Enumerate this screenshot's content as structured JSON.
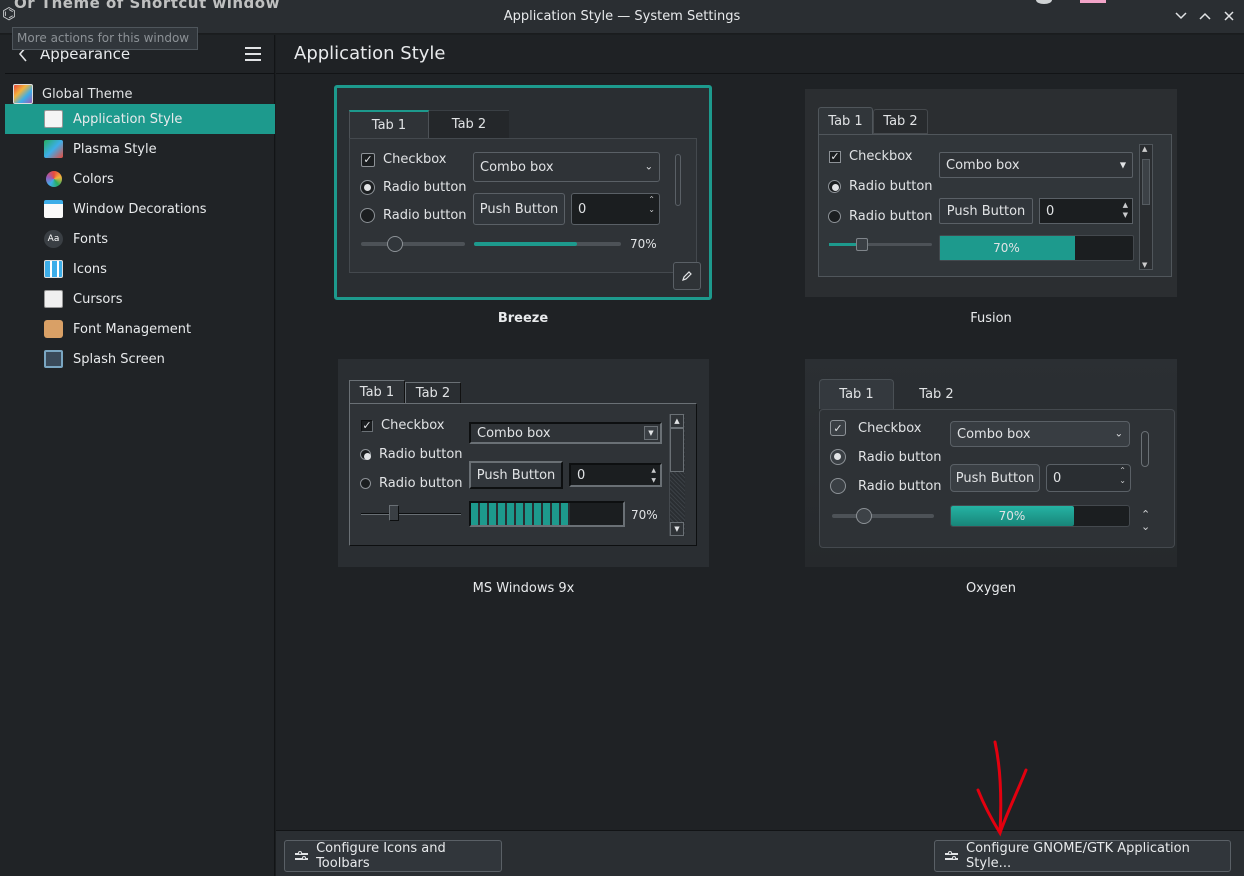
{
  "window": {
    "title": "Application Style — System Settings",
    "tooltip": "More actions for this window",
    "background_peek": "Or Theme of Shortcut window"
  },
  "sidebar": {
    "header_label": "Appearance",
    "global_theme": "Global Theme",
    "items": [
      {
        "label": "Application Style",
        "icon": "application-style-icon",
        "active": true
      },
      {
        "label": "Plasma Style",
        "icon": "plasma-style-icon",
        "active": false
      },
      {
        "label": "Colors",
        "icon": "colors-icon",
        "active": false
      },
      {
        "label": "Window Decorations",
        "icon": "window-decorations-icon",
        "active": false
      },
      {
        "label": "Fonts",
        "icon": "fonts-icon",
        "active": false
      },
      {
        "label": "Icons",
        "icon": "icons-icon",
        "active": false
      },
      {
        "label": "Cursors",
        "icon": "cursors-icon",
        "active": false
      },
      {
        "label": "Font Management",
        "icon": "font-management-icon",
        "active": false
      },
      {
        "label": "Splash Screen",
        "icon": "splash-screen-icon",
        "active": false
      }
    ],
    "fonts_icon_text": "Aa"
  },
  "main": {
    "title": "Application Style",
    "styles": [
      {
        "name": "Breeze",
        "selected": true
      },
      {
        "name": "Fusion",
        "selected": false
      },
      {
        "name": "MS Windows 9x",
        "selected": false
      },
      {
        "name": "Oxygen",
        "selected": false
      }
    ],
    "preview": {
      "tab1": "Tab 1",
      "tab2": "Tab 2",
      "checkbox": "Checkbox",
      "radio": "Radio button",
      "combo": "Combo box",
      "push": "Push Button",
      "spin_value": "0",
      "progress_text": "70%",
      "progress_value": 0.7
    }
  },
  "toolbar": {
    "configure_icons": "Configure Icons and Toolbars",
    "configure_gtk": "Configure GNOME/GTK Application Style..."
  },
  "colors": {
    "accent": "#1d9a8d",
    "annotation": "#e3000f"
  }
}
